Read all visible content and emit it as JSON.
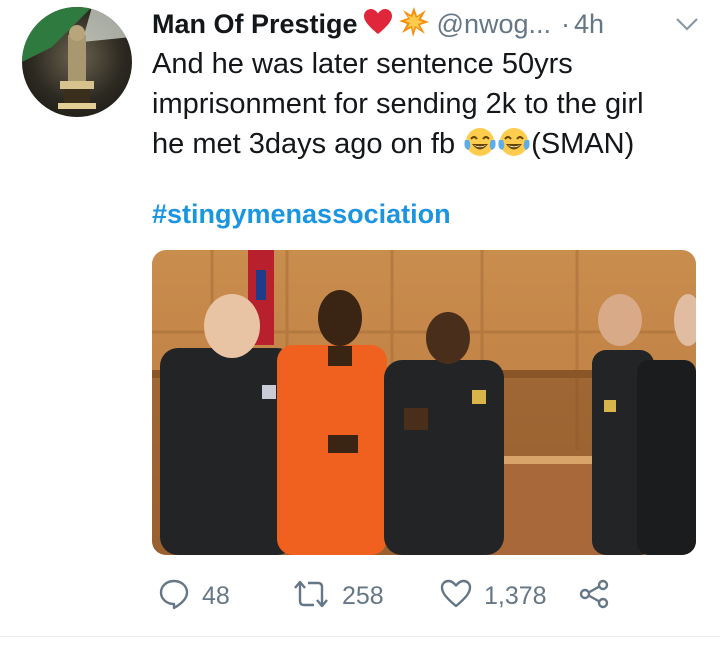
{
  "tweet": {
    "author_name": "Man Of Prestige",
    "handle": "@nwog...",
    "separator": "·",
    "time": "4h",
    "text_lines": [
      "And he was later sentence  50yrs",
      "imprisonment for sending 2k to the girl",
      "he met 3days ago on fb",
      "(SMAN)"
    ],
    "hashtag": "#stingymenassociation"
  },
  "actions": {
    "replies": "48",
    "retweets": "258",
    "likes": "1,378"
  },
  "icons": {
    "heart": "red-heart-emoji",
    "collision": "collision-emoji",
    "laugh": "face-with-tears-of-joy-emoji",
    "caret": "chevron-down-icon",
    "reply": "reply-icon",
    "retweet": "retweet-icon",
    "like": "heart-outline-icon",
    "share": "share-icon"
  },
  "colors": {
    "text": "#14171a",
    "muted": "#657786",
    "link": "#1b95e0",
    "heart": "#e0263a",
    "prisoner_jumpsuit": "#f0601e",
    "uniform": "#222426",
    "wood_panel": "#c78a4a"
  }
}
